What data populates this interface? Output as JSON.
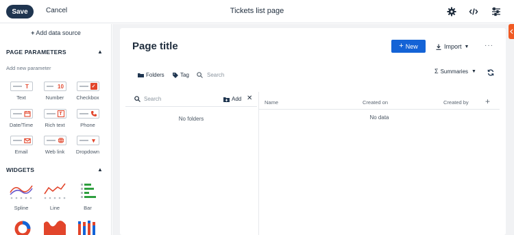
{
  "toolbar": {
    "save_label": "Save",
    "cancel_label": "Cancel",
    "page_name": "Tickets list page",
    "icons": [
      "settings-gear-icon",
      "code-icon",
      "sliders-icon"
    ]
  },
  "left_panel": {
    "add_data_source": "Add data source",
    "page_parameters": {
      "title": "PAGE PARAMETERS",
      "add_new": "Add new parameter",
      "items": [
        {
          "label": "Text",
          "symbol": "T"
        },
        {
          "label": "Number",
          "symbol": "10"
        },
        {
          "label": "Checkbox",
          "symbol": "✓"
        },
        {
          "label": "Date/Time",
          "symbol": "calendar"
        },
        {
          "label": "Rich text",
          "symbol": "T"
        },
        {
          "label": "Phone",
          "symbol": "phone"
        },
        {
          "label": "Email",
          "symbol": "envelope"
        },
        {
          "label": "Web link",
          "symbol": "globe"
        },
        {
          "label": "Dropdown",
          "symbol": "▾"
        }
      ]
    },
    "widgets": {
      "title": "WIDGETS",
      "items": [
        {
          "label": "Spline"
        },
        {
          "label": "Line"
        },
        {
          "label": "Bar"
        }
      ]
    }
  },
  "page": {
    "title": "Page title",
    "new_label": "New",
    "import_label": "Import",
    "more_label": "···",
    "filters": {
      "folders": "Folders",
      "tag": "Tag",
      "search_placeholder": "Search"
    },
    "summaries_label": "Summaries",
    "folder_panel": {
      "search_placeholder": "Search",
      "add_label": "Add",
      "empty": "No folders"
    },
    "table": {
      "columns": [
        "Name",
        "Created on",
        "Created by"
      ],
      "empty": "No data"
    }
  },
  "colors": {
    "primary": "#1463d6",
    "save": "#1f3550",
    "accent": "#e2452b",
    "side_tab": "#f05a23"
  }
}
